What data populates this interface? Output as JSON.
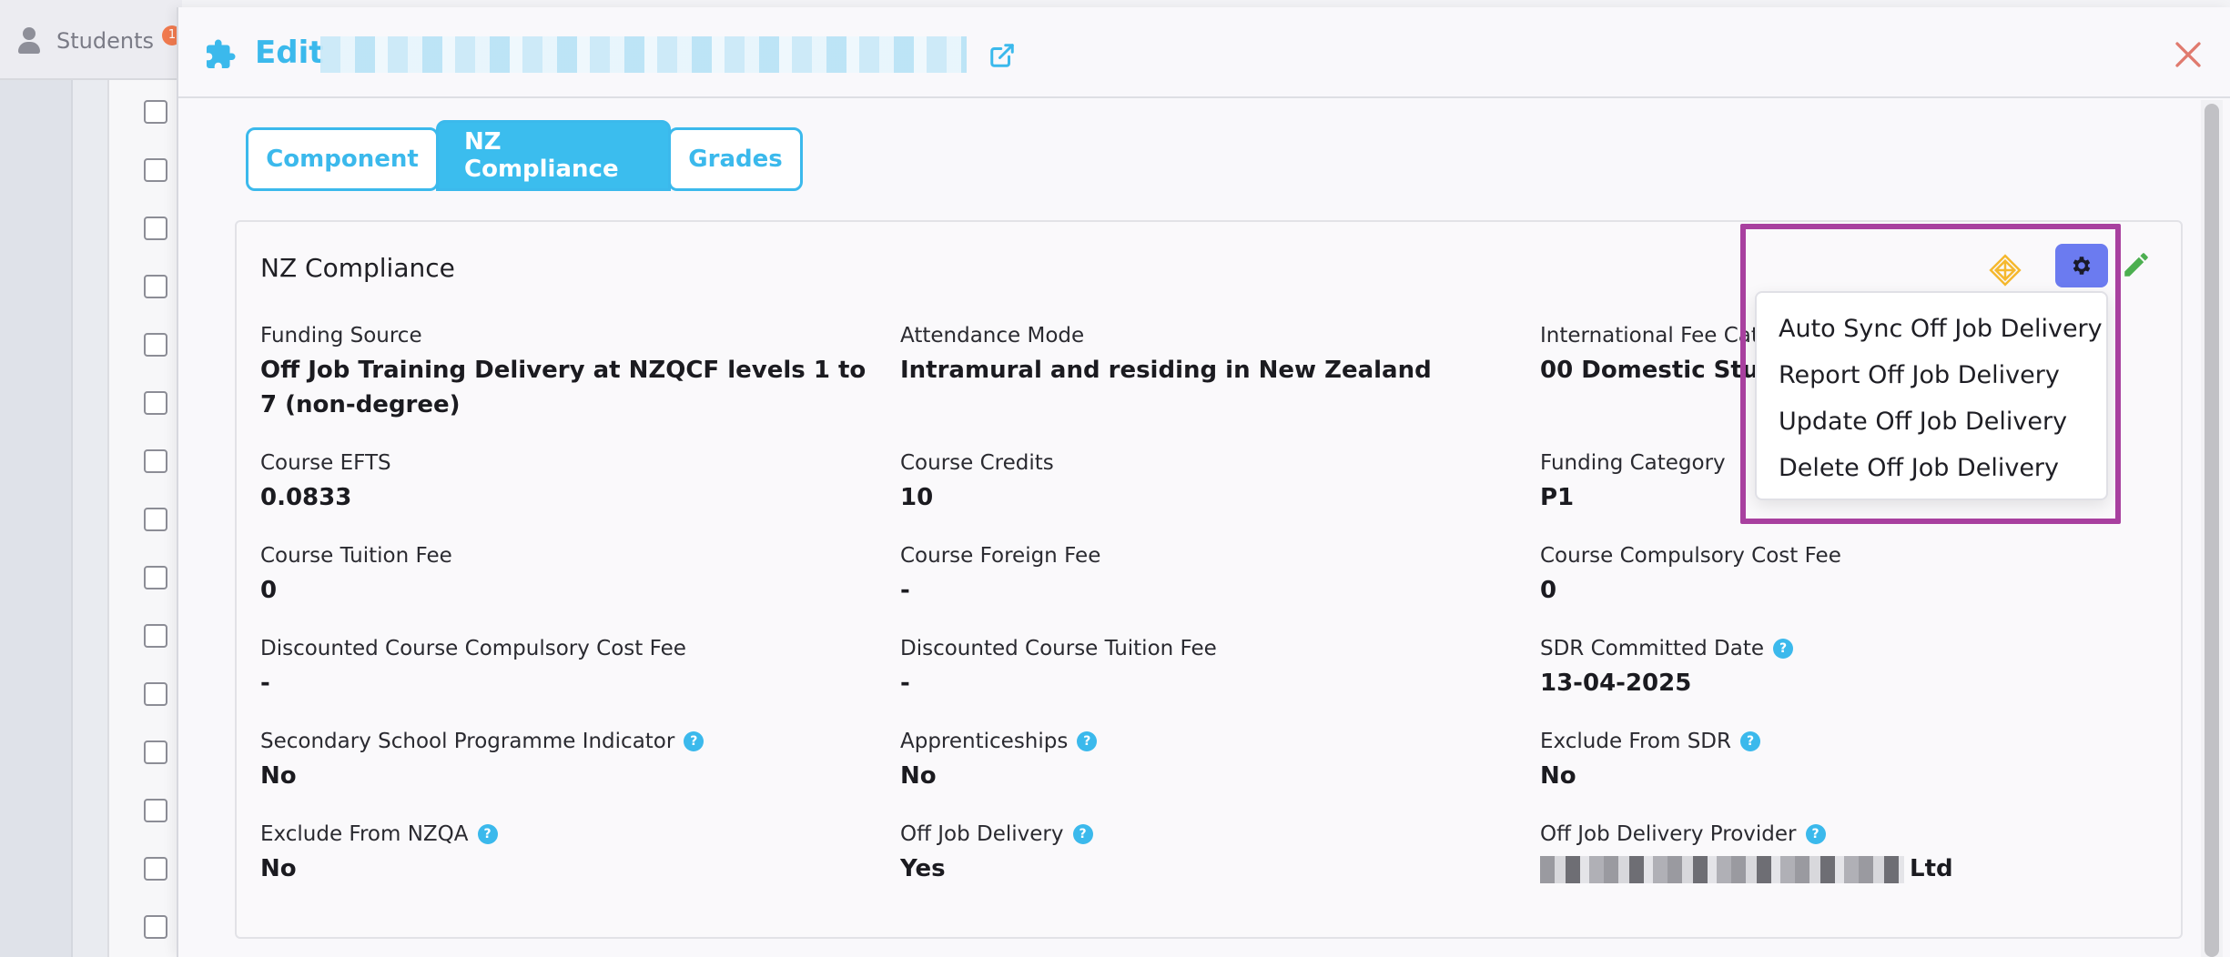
{
  "background": {
    "nav_label": "Students",
    "badge_count": "1",
    "checkbox_count": 15
  },
  "modal": {
    "title": "Edit",
    "tabs": [
      {
        "label": "Component"
      },
      {
        "label": "NZ Compliance"
      },
      {
        "label": "Grades"
      }
    ],
    "active_tab": "NZ Compliance"
  },
  "card": {
    "title": "NZ Compliance",
    "fields": {
      "funding_source": {
        "label": "Funding Source",
        "value": "Off Job Training Delivery at NZQCF levels 1 to 7 (non-degree)"
      },
      "attendance_mode": {
        "label": "Attendance Mode",
        "value": "Intramural and residing in New Zealand"
      },
      "international_fee_cat": {
        "label": "International Fee Cat",
        "value": "00 Domestic Stude"
      },
      "course_efts": {
        "label": "Course EFTS",
        "value": "0.0833"
      },
      "course_credits": {
        "label": "Course Credits",
        "value": "10"
      },
      "funding_category": {
        "label": "Funding Category",
        "value": "P1"
      },
      "course_tuition_fee": {
        "label": "Course Tuition Fee",
        "value": "0"
      },
      "course_foreign_fee": {
        "label": "Course Foreign Fee",
        "value": "-"
      },
      "course_compulsory_cost_fee": {
        "label": "Course Compulsory Cost Fee",
        "value": "0"
      },
      "discounted_compulsory_cost_fee": {
        "label": "Discounted Course Compulsory Cost Fee",
        "value": "-"
      },
      "discounted_tuition_fee": {
        "label": "Discounted Course Tuition Fee",
        "value": "-"
      },
      "sdr_committed_date": {
        "label": "SDR Committed Date",
        "value": "13-04-2025"
      },
      "secondary_school_indicator": {
        "label": "Secondary School Programme Indicator",
        "value": "No"
      },
      "apprenticeships": {
        "label": "Apprenticeships",
        "value": "No"
      },
      "exclude_from_sdr": {
        "label": "Exclude From SDR",
        "value": "No"
      },
      "exclude_from_nzqa": {
        "label": "Exclude From NZQA",
        "value": "No"
      },
      "off_job_delivery": {
        "label": "Off Job Delivery",
        "value": "Yes"
      },
      "off_job_delivery_provider": {
        "label": "Off Job Delivery Provider",
        "value": "Ltd"
      }
    }
  },
  "actions_menu": {
    "items": [
      {
        "label": "Auto Sync Off Job Delivery"
      },
      {
        "label": "Report Off Job Delivery"
      },
      {
        "label": "Update Off Job Delivery"
      },
      {
        "label": "Delete Off Job Delivery"
      }
    ]
  },
  "colors": {
    "accent": "#3bb9ec",
    "gear_button": "#6b7bf0",
    "highlight": "#a8409f",
    "close": "#e07a6e",
    "edit": "#4caf50",
    "sync": "#f5b82e"
  }
}
